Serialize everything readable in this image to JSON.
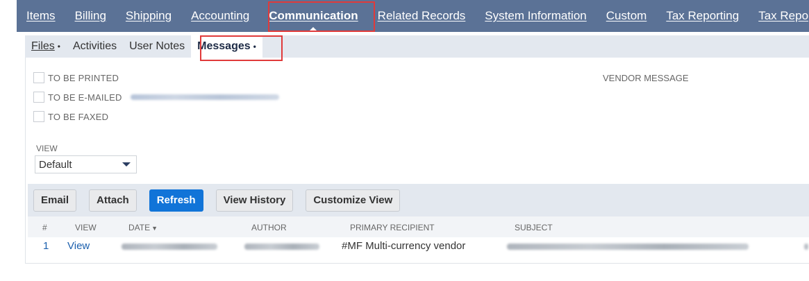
{
  "top_tabs": [
    "Items",
    "Billing",
    "Shipping",
    "Accounting",
    "Communication",
    "Related Records",
    "System Information",
    "Custom",
    "Tax Reporting",
    "Tax Repo"
  ],
  "active_top_tab": "Communication",
  "sub_tabs": {
    "files": "Files",
    "activities": "Activities",
    "user_notes": "User Notes",
    "messages": "Messages",
    "dot": "•"
  },
  "checkboxes": {
    "to_be_printed": "TO BE PRINTED",
    "to_be_emailed": "TO BE E-MAILED",
    "to_be_faxed": "TO BE FAXED"
  },
  "vendor_message_label": "VENDOR MESSAGE",
  "view": {
    "label": "VIEW",
    "selected": "Default"
  },
  "toolbar": {
    "email": "Email",
    "attach": "Attach",
    "refresh": "Refresh",
    "view_history": "View History",
    "customize_view": "Customize View"
  },
  "table": {
    "headers": {
      "num": "#",
      "view": "VIEW",
      "date": "DATE",
      "date_sort": "▼",
      "author": "AUTHOR",
      "primary_recipient": "PRIMARY RECIPIENT",
      "subject": "SUBJECT"
    },
    "rows": [
      {
        "num": "1",
        "view": "View",
        "primary_recipient": "#MF Multi-currency vendor"
      }
    ]
  },
  "colors": {
    "topbar": "#5b7296",
    "subbar": "#e3e8ef",
    "primary_button": "#1174d8",
    "highlight": "#e03a3a",
    "link": "#1b5fad"
  }
}
